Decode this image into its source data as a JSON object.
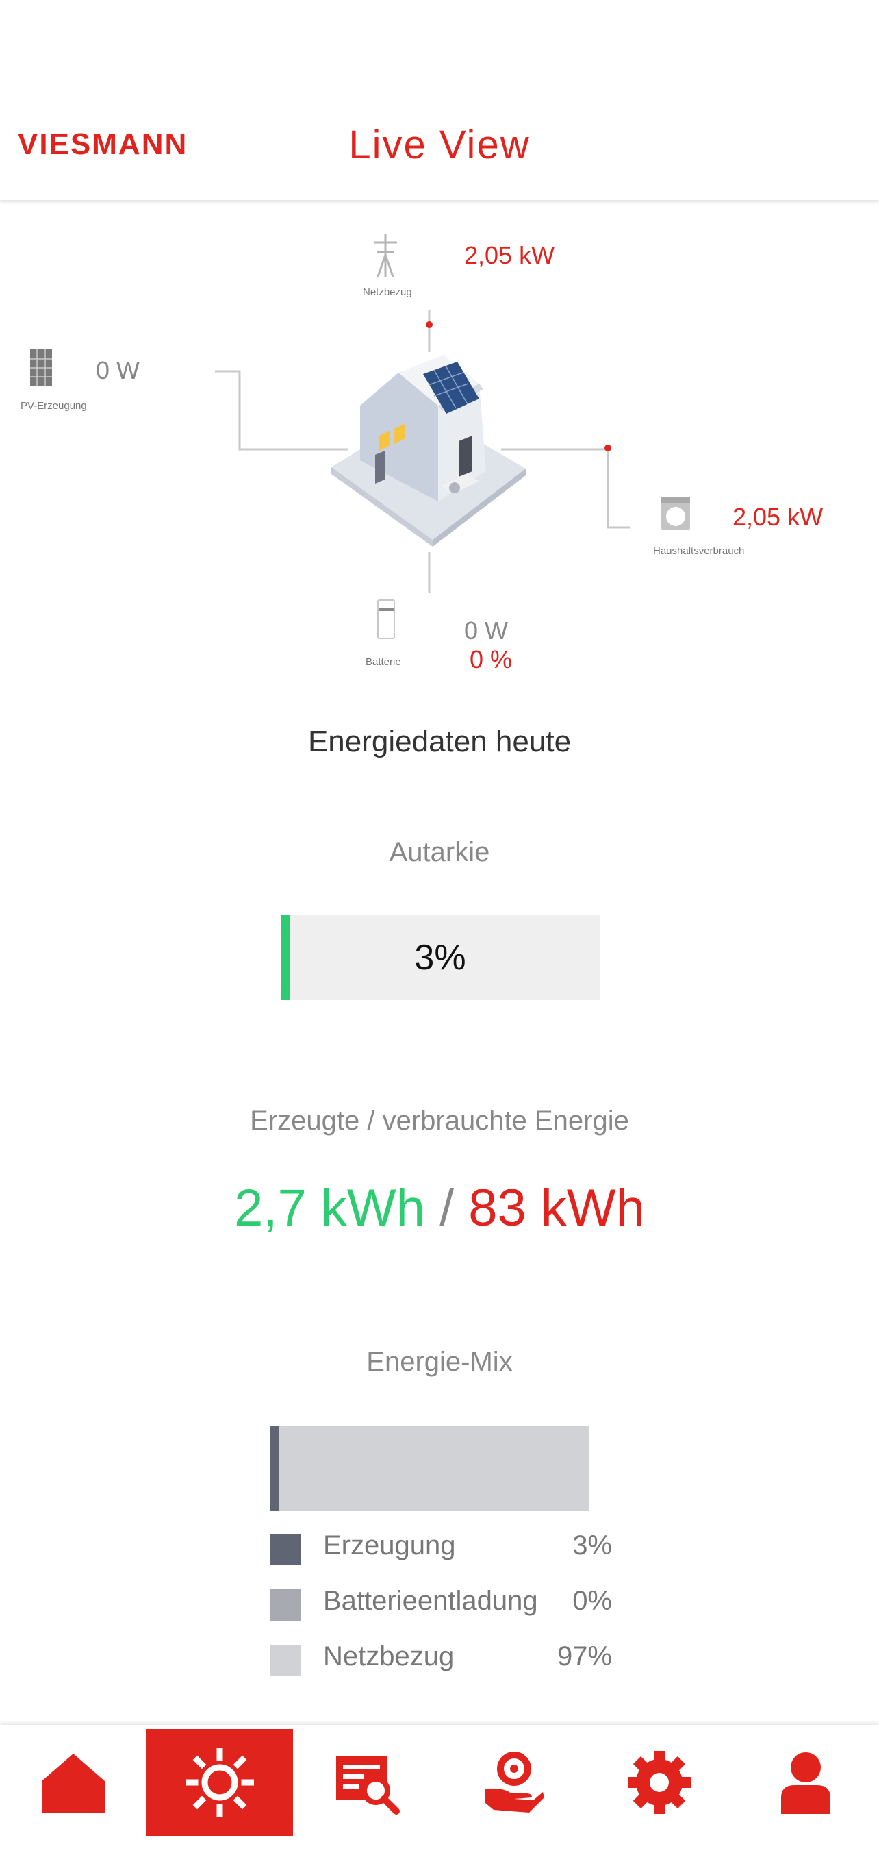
{
  "header": {
    "logo_text": "VIESMANN",
    "title": "Live View"
  },
  "live": {
    "grid": {
      "label": "Netzbezug",
      "value": "2,05 kW",
      "icon": "power-tower-icon"
    },
    "pv": {
      "label": "PV-Erzeugung",
      "value": "0 W",
      "icon": "solar-panel-icon"
    },
    "household": {
      "label": "Haushaltsverbrauch",
      "value": "2,05 kW",
      "icon": "washing-machine-icon"
    },
    "battery": {
      "label": "Batterie",
      "value": "0 W",
      "percent": "0 %",
      "icon": "battery-icon"
    }
  },
  "energy_today": {
    "title": "Energiedaten heute",
    "autarkie": {
      "label": "Autarkie",
      "value": "3%",
      "fraction": 0.03
    },
    "energy": {
      "label": "Erzeugte / verbrauchte Energie",
      "produced": "2,7 kWh",
      "separator": "/",
      "consumed": "83 kWh"
    },
    "mix": {
      "label": "Energie-Mix",
      "items": [
        {
          "label": "Erzeugung",
          "value": "3%",
          "fraction": 0.03,
          "color": "#5f6573"
        },
        {
          "label": "Batterieentladung",
          "value": "0%",
          "fraction": 0.0,
          "color": "#a7aab1"
        },
        {
          "label": "Netzbezug",
          "value": "97%",
          "fraction": 0.97,
          "color": "#d1d2d6"
        }
      ]
    }
  },
  "colors": {
    "accent": "#e0231c",
    "produced": "#2ecc71",
    "muted": "#888888"
  },
  "nav": [
    {
      "icon": "home-icon",
      "active": false
    },
    {
      "icon": "sun-icon",
      "active": true
    },
    {
      "icon": "report-search-icon",
      "active": false
    },
    {
      "icon": "hand-service-icon",
      "active": false
    },
    {
      "icon": "gear-icon",
      "active": false
    },
    {
      "icon": "user-icon",
      "active": false
    }
  ]
}
